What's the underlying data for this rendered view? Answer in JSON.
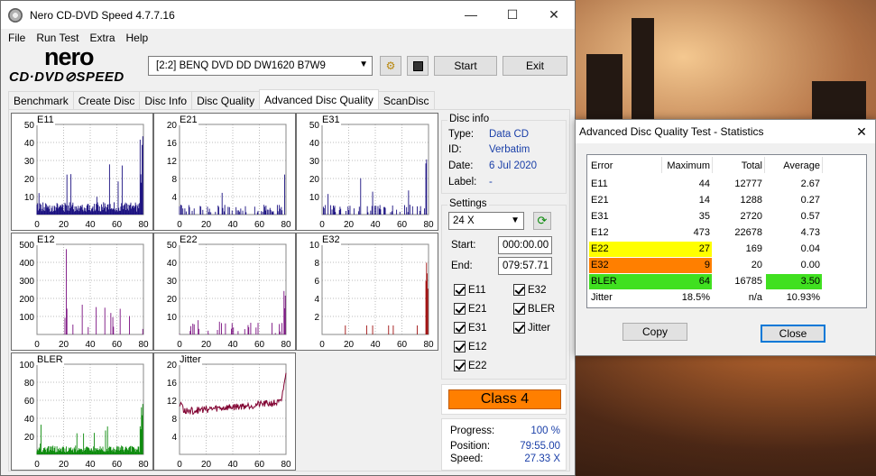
{
  "app": {
    "title": "Nero CD-DVD Speed 4.7.7.16",
    "logo_top": "nero",
    "logo_bottom": "CD·DVD⊘SPEED"
  },
  "menu": [
    "File",
    "Run Test",
    "Extra",
    "Help"
  ],
  "toolbar": {
    "drive": "[2:2]   BENQ DVD DD DW1620 B7W9",
    "start_label": "Start",
    "exit_label": "Exit"
  },
  "tabs": [
    "Benchmark",
    "Create Disc",
    "Disc Info",
    "Disc Quality",
    "Advanced Disc Quality",
    "ScanDisc"
  ],
  "active_tab": "Advanced Disc Quality",
  "disc_info": {
    "title": "Disc info",
    "type_label": "Type:",
    "type_value": "Data CD",
    "id_label": "ID:",
    "id_value": "Verbatim",
    "date_label": "Date:",
    "date_value": "6 Jul 2020",
    "label_label": "Label:",
    "label_value": "-"
  },
  "settings": {
    "title": "Settings",
    "speed": "24 X",
    "start_label": "Start:",
    "start_value": "000:00.00",
    "end_label": "End:",
    "end_value": "079:57.71",
    "checkboxes": [
      "E11",
      "E32",
      "E21",
      "BLER",
      "E31",
      "Jitter",
      "E12",
      "E22"
    ]
  },
  "class_label": "Class 4",
  "progress": {
    "progress_label": "Progress:",
    "progress_value": "100 %",
    "position_label": "Position:",
    "position_value": "79:55.00",
    "speed_label": "Speed:",
    "speed_value": "27.33 X"
  },
  "colors": {
    "e_series": "#1a1080",
    "e2_series": "#7a1080",
    "e32_series": "#a01010",
    "bler_series": "#0a8a0a",
    "jitter_series": "#800030",
    "yellow": "#ffff00",
    "orange": "#ff7f00",
    "green": "#40e020",
    "class_bg": "#ff7f00"
  },
  "chart_data": [
    {
      "type": "bar",
      "name": "E11",
      "ylim": [
        0,
        50
      ],
      "yticks": [
        10,
        20,
        30,
        40,
        50
      ],
      "xticks": [
        0,
        20,
        40,
        60,
        80
      ],
      "xlim": [
        0,
        80
      ],
      "peak": 44
    },
    {
      "type": "bar",
      "name": "E21",
      "ylim": [
        0,
        20
      ],
      "yticks": [
        4,
        8,
        12,
        16,
        20
      ],
      "xticks": [
        0,
        20,
        40,
        60,
        80
      ],
      "xlim": [
        0,
        80
      ],
      "peak": 14
    },
    {
      "type": "bar",
      "name": "E31",
      "ylim": [
        0,
        50
      ],
      "yticks": [
        10,
        20,
        30,
        40,
        50
      ],
      "xticks": [
        0,
        20,
        40,
        60,
        80
      ],
      "xlim": [
        0,
        80
      ],
      "peak": 35
    },
    {
      "type": "bar",
      "name": "E12",
      "ylim": [
        0,
        500
      ],
      "yticks": [
        100,
        200,
        300,
        400,
        500
      ],
      "xticks": [
        0,
        20,
        40,
        60,
        80
      ],
      "xlim": [
        0,
        80
      ],
      "peak": 473
    },
    {
      "type": "bar",
      "name": "E22",
      "ylim": [
        0,
        50
      ],
      "yticks": [
        10,
        20,
        30,
        40,
        50
      ],
      "xticks": [
        0,
        20,
        40,
        60,
        80
      ],
      "xlim": [
        0,
        80
      ],
      "peak": 27
    },
    {
      "type": "bar",
      "name": "E32",
      "ylim": [
        0,
        10
      ],
      "yticks": [
        2,
        4,
        6,
        8,
        10
      ],
      "xticks": [
        0,
        20,
        40,
        60,
        80
      ],
      "xlim": [
        0,
        80
      ],
      "peak": 9
    },
    {
      "type": "bar",
      "name": "BLER",
      "ylim": [
        0,
        100
      ],
      "yticks": [
        20,
        40,
        60,
        80,
        100
      ],
      "xticks": [
        0,
        20,
        40,
        60,
        80
      ],
      "xlim": [
        0,
        80
      ],
      "peak": 64
    },
    {
      "type": "line",
      "name": "Jitter",
      "ylim": [
        0,
        20
      ],
      "yticks": [
        4,
        8,
        12,
        16,
        20
      ],
      "xticks": [
        0,
        20,
        40,
        60,
        80
      ],
      "xlim": [
        0,
        80
      ],
      "peak": 18.5,
      "average": 10.93
    }
  ],
  "stats_dialog": {
    "title": "Advanced Disc Quality Test - Statistics",
    "headers": [
      "Error",
      "Maximum",
      "Total",
      "Average"
    ],
    "rows": [
      {
        "error": "E11",
        "maximum": "44",
        "total": "12777",
        "average": "2.67",
        "hl": ""
      },
      {
        "error": "E21",
        "maximum": "14",
        "total": "1288",
        "average": "0.27",
        "hl": ""
      },
      {
        "error": "E31",
        "maximum": "35",
        "total": "2720",
        "average": "0.57",
        "hl": ""
      },
      {
        "error": "E12",
        "maximum": "473",
        "total": "22678",
        "average": "4.73",
        "hl": ""
      },
      {
        "error": "E22",
        "maximum": "27",
        "total": "169",
        "average": "0.04",
        "hl": "yellow"
      },
      {
        "error": "E32",
        "maximum": "9",
        "total": "20",
        "average": "0.00",
        "hl": "orange"
      },
      {
        "error": "BLER",
        "maximum": "64",
        "total": "16785",
        "average": "3.50",
        "hl": "green"
      },
      {
        "error": "Jitter",
        "maximum": "18.5%",
        "total": "n/a",
        "average": "10.93%",
        "hl": ""
      }
    ],
    "copy_label": "Copy",
    "close_label": "Close"
  }
}
